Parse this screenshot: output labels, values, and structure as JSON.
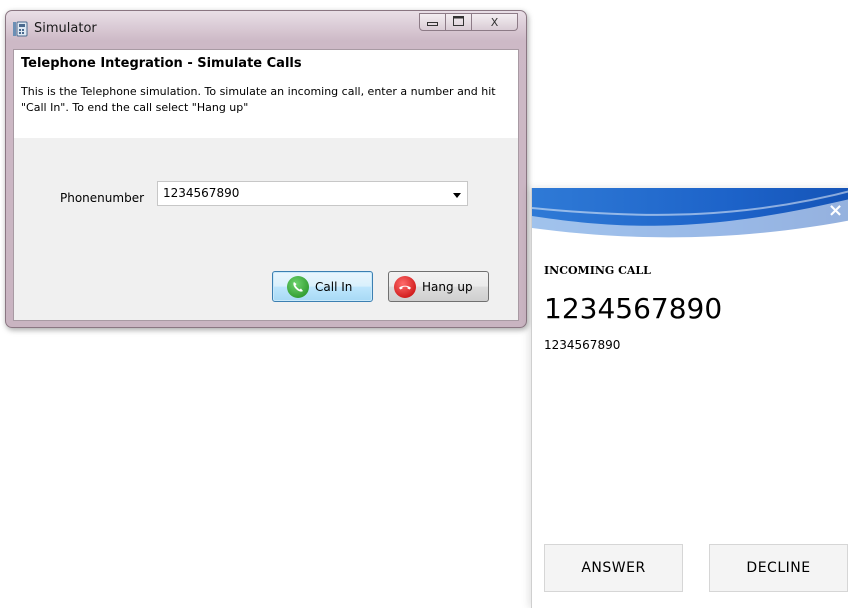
{
  "simulator": {
    "window_title": "Simulator",
    "controls": {
      "minimize_icon": "minimize-icon",
      "maximize_icon": "maximize-icon",
      "close_glyph": "X"
    },
    "heading": "Telephone Integration - Simulate Calls",
    "description": "This is the Telephone simulation. To simulate an incoming call, enter a number  and hit \"Call In\". To end the call select \"Hang up\"",
    "phone_label": "Phonenumber",
    "phone_value": "1234567890",
    "call_in_label": "Call In",
    "hang_up_label": "Hang up"
  },
  "toast": {
    "close_glyph": "×",
    "incoming_label": "INCOMING CALL",
    "caller_number": "1234567890",
    "caller_sub": "1234567890",
    "answer_label": "ANSWER",
    "decline_label": "DECLINE"
  },
  "colors": {
    "banner_blue": "#2a6fd0",
    "call_green": "#1d8a1d",
    "hangup_red": "#c00000"
  }
}
